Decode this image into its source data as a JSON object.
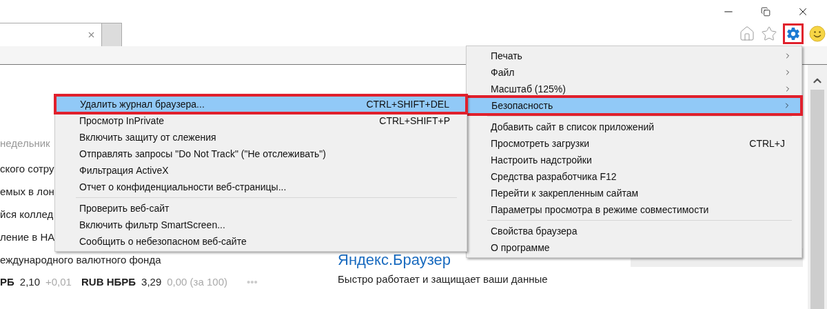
{
  "page": {
    "date_fragment": "недельник",
    "headlines": [
      "ского сотру",
      "емых в лон",
      "йся коллед",
      "ление в НА",
      "еждународного валютного фонда"
    ],
    "currency": [
      {
        "code": "РБ",
        "rate": "2,10",
        "change": "+0,01"
      },
      {
        "code": "RUB НБРБ",
        "rate": "3,29",
        "change": "0,00 (за 100)"
      }
    ],
    "currency_more": "•••",
    "ad": {
      "title": "Яндекс.Браузер",
      "text": "Быстро работает и защищает ваши данные"
    }
  },
  "tools_menu": {
    "groups": [
      [
        {
          "label": "Печать",
          "has_submenu": true,
          "selected": false
        },
        {
          "label": "Файл",
          "has_submenu": true,
          "selected": false
        },
        {
          "label": "Масштаб (125%)",
          "has_submenu": true,
          "selected": false
        },
        {
          "label": "Безопасность",
          "has_submenu": true,
          "selected": true
        }
      ],
      [
        {
          "label": "Добавить сайт в список приложений",
          "has_submenu": false,
          "selected": false
        },
        {
          "label": "Просмотреть загрузки",
          "shortcut": "CTRL+J",
          "has_submenu": false,
          "selected": false
        },
        {
          "label": "Настроить надстройки",
          "has_submenu": false,
          "selected": false
        },
        {
          "label": "Средства разработчика F12",
          "has_submenu": false,
          "selected": false
        },
        {
          "label": "Перейти к закрепленным сайтам",
          "has_submenu": false,
          "selected": false
        },
        {
          "label": "Параметры просмотра в режиме совместимости",
          "has_submenu": false,
          "selected": false
        }
      ],
      [
        {
          "label": "Свойства браузера",
          "has_submenu": false,
          "selected": false
        },
        {
          "label": "О программе",
          "has_submenu": false,
          "selected": false
        }
      ]
    ]
  },
  "safety_submenu": {
    "groups": [
      [
        {
          "label": "Удалить журнал браузера...",
          "shortcut": "CTRL+SHIFT+DEL",
          "selected": true
        },
        {
          "label": "Просмотр InPrivate",
          "shortcut": "CTRL+SHIFT+P",
          "selected": false
        },
        {
          "label": "Включить защиту от слежения",
          "selected": false
        },
        {
          "label": "Отправлять запросы \"Do Not Track\" (\"Не отслеживать\")",
          "selected": false
        },
        {
          "label": "Фильтрация ActiveX",
          "selected": false
        },
        {
          "label": "Отчет о конфиденциальности веб-страницы...",
          "selected": false
        }
      ],
      [
        {
          "label": "Проверить веб-сайт",
          "selected": false
        },
        {
          "label": "Включить фильтр SmartScreen...",
          "selected": false
        },
        {
          "label": "Сообщить о небезопасном веб-сайте",
          "selected": false
        }
      ]
    ]
  }
}
